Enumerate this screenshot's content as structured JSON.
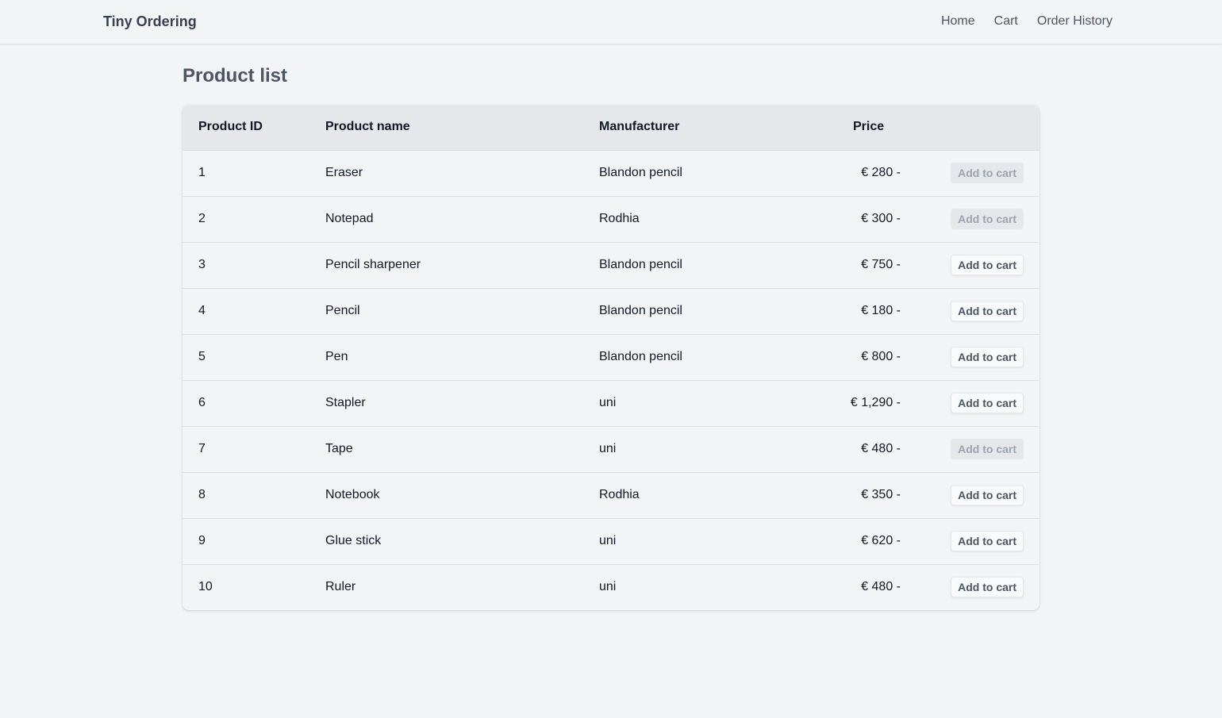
{
  "nav": {
    "brand": "Tiny Ordering",
    "links": [
      "Home",
      "Cart",
      "Order History"
    ]
  },
  "page": {
    "title": "Product list"
  },
  "table": {
    "headers": [
      "Product ID",
      "Product name",
      "Manufacturer",
      "Price"
    ],
    "rows": [
      {
        "id": "1",
        "name": "Eraser",
        "manufacturer": "Blandon pencil",
        "price": "€ 280 -",
        "button": "Add to cart",
        "enabled": false
      },
      {
        "id": "2",
        "name": "Notepad",
        "manufacturer": "Rodhia",
        "price": "€ 300 -",
        "button": "Add to cart",
        "enabled": false
      },
      {
        "id": "3",
        "name": "Pencil sharpener",
        "manufacturer": "Blandon pencil",
        "price": "€ 750 -",
        "button": "Add to cart",
        "enabled": true
      },
      {
        "id": "4",
        "name": "Pencil",
        "manufacturer": "Blandon pencil",
        "price": "€ 180 -",
        "button": "Add to cart",
        "enabled": true
      },
      {
        "id": "5",
        "name": "Pen",
        "manufacturer": "Blandon pencil",
        "price": "€ 800 -",
        "button": "Add to cart",
        "enabled": true
      },
      {
        "id": "6",
        "name": "Stapler",
        "manufacturer": "uni",
        "price": "€ 1,290 -",
        "button": "Add to cart",
        "enabled": true
      },
      {
        "id": "7",
        "name": "Tape",
        "manufacturer": "uni",
        "price": "€ 480 -",
        "button": "Add to cart",
        "enabled": false
      },
      {
        "id": "8",
        "name": "Notebook",
        "manufacturer": "Rodhia",
        "price": "€ 350 -",
        "button": "Add to cart",
        "enabled": true
      },
      {
        "id": "9",
        "name": "Glue stick",
        "manufacturer": "uni",
        "price": "€ 620 -",
        "button": "Add to cart",
        "enabled": true
      },
      {
        "id": "10",
        "name": "Ruler",
        "manufacturer": "uni",
        "price": "€ 480 -",
        "button": "Add to cart",
        "enabled": true
      }
    ]
  }
}
